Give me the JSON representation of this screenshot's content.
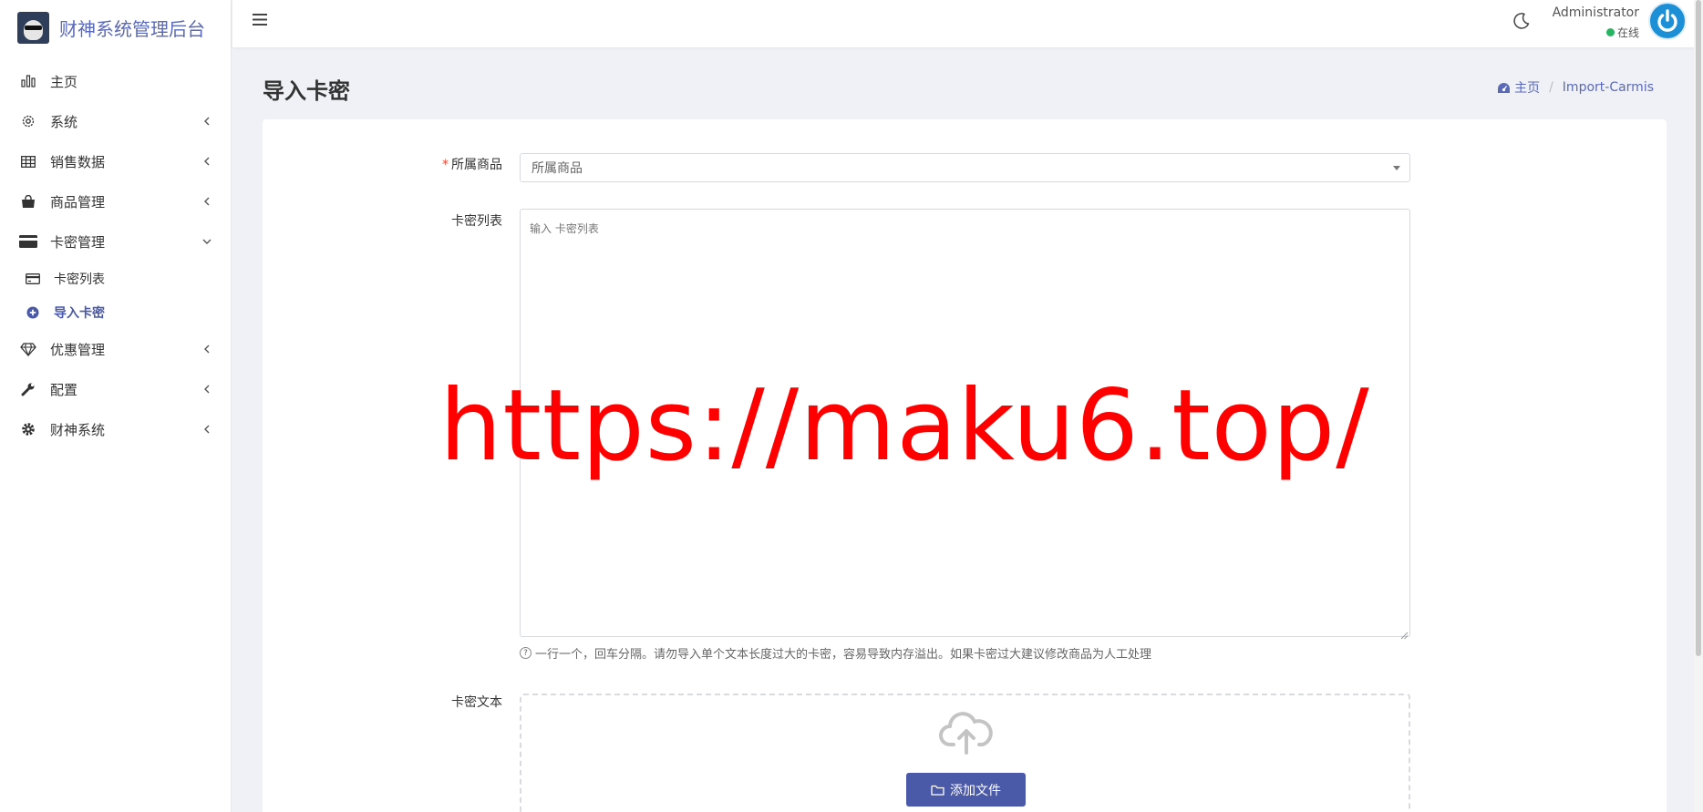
{
  "brand": {
    "title": "财神系统管理后台"
  },
  "sidebar": {
    "items": [
      {
        "label": "主页",
        "icon": "bar-chart-icon"
      },
      {
        "label": "系统",
        "icon": "gear-outline-icon"
      },
      {
        "label": "销售数据",
        "icon": "table-icon"
      },
      {
        "label": "商品管理",
        "icon": "shopping-bag-icon"
      },
      {
        "label": "卡密管理",
        "icon": "credit-card-icon",
        "expanded": true
      },
      {
        "label": "优惠管理",
        "icon": "diamond-icon"
      },
      {
        "label": "配置",
        "icon": "wrench-icon"
      },
      {
        "label": "财神系统",
        "icon": "cog-icon"
      }
    ],
    "subitems": [
      {
        "label": "卡密列表",
        "icon": "card-icon"
      },
      {
        "label": "导入卡密",
        "icon": "plus-circle-icon",
        "active": true
      }
    ]
  },
  "topbar": {
    "user_name": "Administrator",
    "user_status": "在线"
  },
  "page": {
    "title": "导入卡密",
    "breadcrumb": {
      "home": "主页",
      "current": "Import-Carmis"
    }
  },
  "form": {
    "product_label": "所属商品",
    "product_placeholder": "所属商品",
    "list_label": "卡密列表",
    "list_placeholder": "输入 卡密列表",
    "help": "一行一个，回车分隔。请勿导入单个文本长度过大的卡密，容易导致内存溢出。如果卡密过大建议修改商品为人工处理",
    "file_label": "卡密文本",
    "add_file_button": "添加文件"
  },
  "watermark": "https://maku6.top/",
  "colors": {
    "accent": "#4b5aa8",
    "required": "#e74c3c",
    "online": "#28b463",
    "watermark": "#ff0000"
  }
}
